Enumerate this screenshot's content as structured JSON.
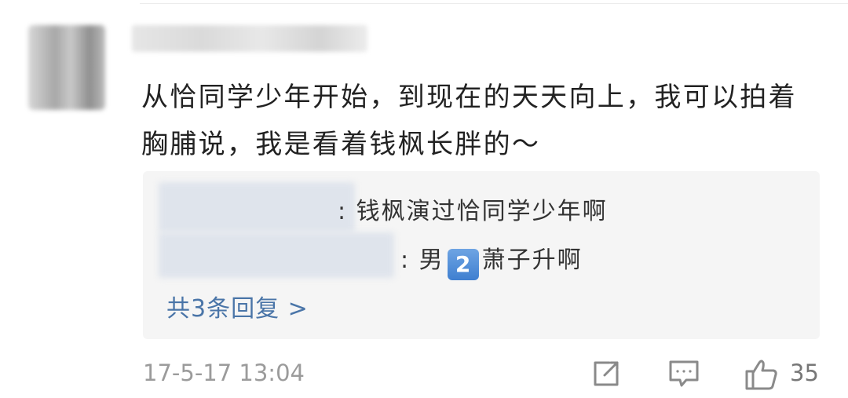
{
  "comment": {
    "text": "从恰同学少年开始，到现在的天天向上，我可以拍着胸脯说，我是看着钱枫长胖的～"
  },
  "replies": {
    "items": [
      {
        "sep": ":",
        "text": "钱枫演过恰同学少年啊"
      },
      {
        "sep": ":",
        "text_before": "男",
        "badge": "2",
        "text_after": "萧子升啊"
      }
    ],
    "more_label": "共3条回复 >"
  },
  "footer": {
    "timestamp": "17-5-17 13:04",
    "like_count": "35"
  },
  "icons": {
    "share": "share-icon",
    "comment": "comment-icon",
    "like": "thumbs-up-icon"
  },
  "colors": {
    "link": "#4a75a8",
    "badge": "#4f8ad6"
  }
}
